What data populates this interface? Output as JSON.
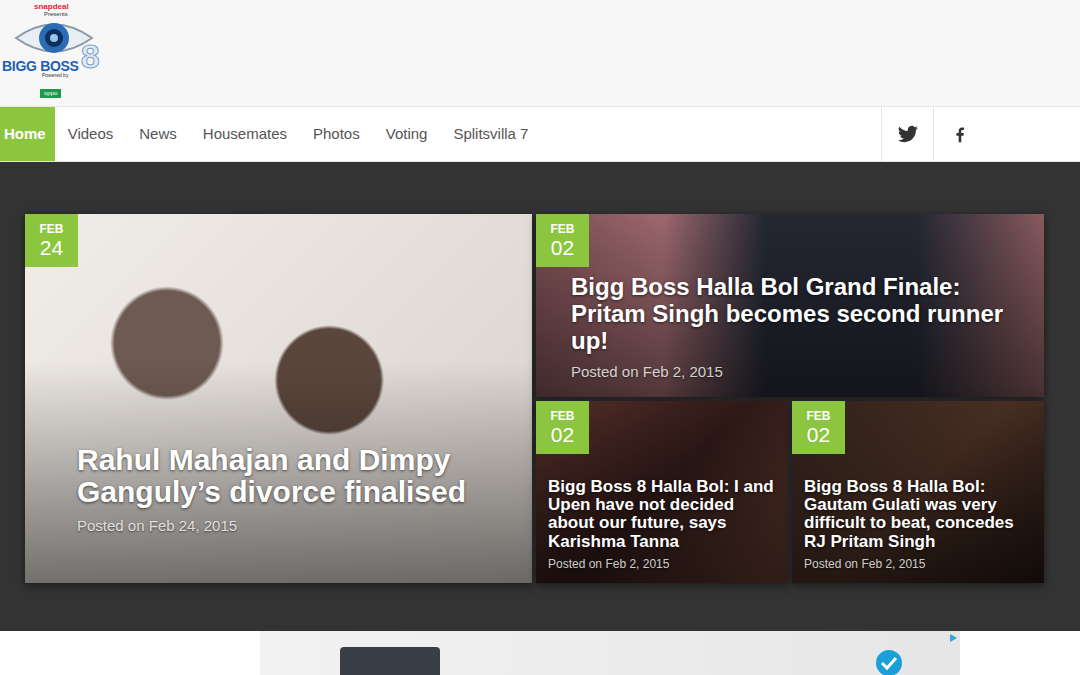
{
  "logo": {
    "sponsor": "snapdeal",
    "presents": "Presents",
    "title": "BIGG BOSS",
    "season": "8",
    "powered_by": "Powered by",
    "partner": "oppo"
  },
  "nav": {
    "items": [
      {
        "label": "Home",
        "selected": true
      },
      {
        "label": "Videos",
        "selected": false
      },
      {
        "label": "News",
        "selected": false
      },
      {
        "label": "Housemates",
        "selected": false
      },
      {
        "label": "Photos",
        "selected": false
      },
      {
        "label": "Voting",
        "selected": false
      },
      {
        "label": "Splitsvilla 7",
        "selected": false
      }
    ]
  },
  "posts": [
    {
      "month": "FEB",
      "day": "24",
      "title": "Rahul Mahajan and Dimpy Ganguly’s divorce finalised",
      "posted": "Posted on Feb 24, 2015"
    },
    {
      "month": "FEB",
      "day": "02",
      "title": "Bigg Boss Halla Bol Grand Finale: Pritam Singh becomes second runner up!",
      "posted": "Posted on Feb 2, 2015"
    },
    {
      "month": "FEB",
      "day": "02",
      "title": "Bigg Boss 8 Halla Bol: I and Upen have not decided about our future, says Karishma Tanna",
      "posted": "Posted on Feb 2, 2015"
    },
    {
      "month": "FEB",
      "day": "02",
      "title": "Bigg Boss 8 Halla Bol: Gautam Gulati was very difficult to beat, concedes RJ Pritam Singh",
      "posted": "Posted on Feb 2, 2015"
    }
  ]
}
